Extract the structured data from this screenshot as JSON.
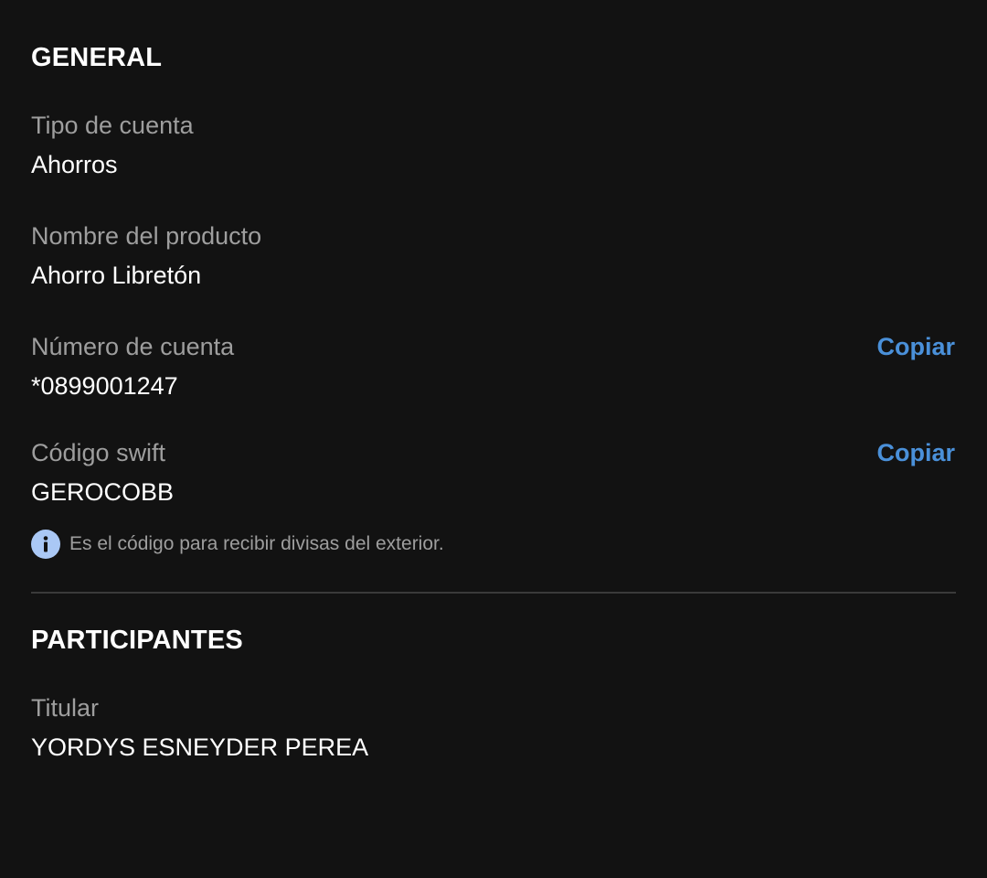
{
  "general": {
    "title": "GENERAL",
    "account_type": {
      "label": "Tipo de cuenta",
      "value": "Ahorros"
    },
    "product_name": {
      "label": "Nombre del producto",
      "value": "Ahorro Libretón"
    },
    "account_number": {
      "label": "Número de cuenta",
      "value": "*0899001247",
      "copy_label": "Copiar"
    },
    "swift_code": {
      "label": "Código swift",
      "value": "GEROCOBB",
      "copy_label": "Copiar"
    },
    "swift_info": {
      "icon": "info-icon",
      "text": "Es el código para recibir divisas del exterior."
    }
  },
  "participants": {
    "title": "PARTICIPANTES",
    "holder": {
      "label": "Titular",
      "value": "YORDYS ESNEYDER PEREA"
    }
  },
  "colors": {
    "background": "#121212",
    "accent": "#4a90d9",
    "label": "#9e9e9e",
    "info_icon_bg": "#aac8f5"
  }
}
